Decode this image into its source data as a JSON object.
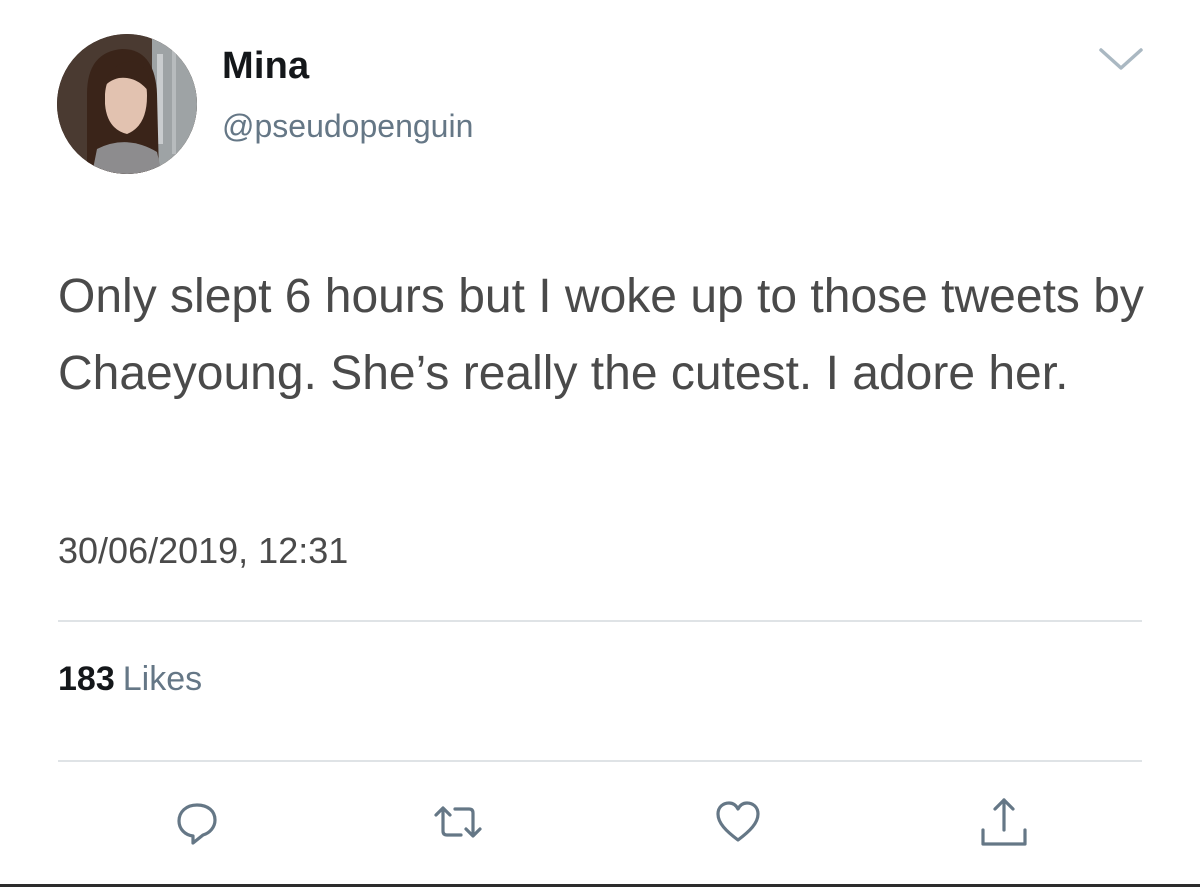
{
  "user": {
    "display_name": "Mina",
    "handle": "@pseudopenguin"
  },
  "tweet": {
    "text": "Only slept 6 hours but I woke up to those tweets by Chaeyoung. She’s really the cutest. I adore her.",
    "timestamp": "30/06/2019, 12:31"
  },
  "stats": {
    "likes_count": "183",
    "likes_label": "Likes"
  },
  "icons": {
    "menu": "chevron-down-icon",
    "reply": "reply-icon",
    "retweet": "retweet-icon",
    "like": "heart-icon",
    "share": "share-icon"
  },
  "colors": {
    "icon": "#657786",
    "secondary_text": "#657786",
    "divider": "#dfe3e6"
  }
}
